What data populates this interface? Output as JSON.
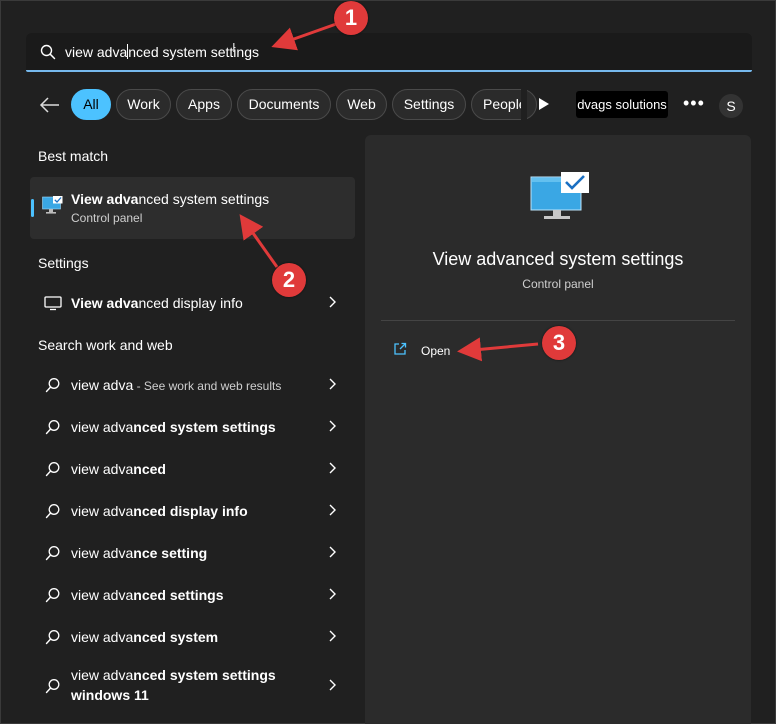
{
  "search": {
    "value_pre": "view adva",
    "value_post": "nced system settings",
    "ibeam": "I"
  },
  "filters": {
    "chips": [
      "All",
      "Work",
      "Apps",
      "Documents",
      "Web",
      "Settings",
      "People"
    ],
    "active": "All",
    "org_label": "dvags solutions",
    "more_label": "•••",
    "avatar_label": "S"
  },
  "sections": {
    "best_match": "Best match",
    "settings": "Settings",
    "search_web": "Search work and web"
  },
  "best_match": {
    "title_bold": "View adva",
    "title_rest": "nced system settings",
    "subtitle": "Control panel"
  },
  "settings_items": [
    {
      "bold": "View adva",
      "rest": "nced display info"
    }
  ],
  "web_items": [
    {
      "pre": "view adva",
      "post": "",
      "sub": " - See work and web results"
    },
    {
      "pre": "view adva",
      "post": "nced system settings",
      "sub": ""
    },
    {
      "pre": "view adva",
      "post": "nced",
      "sub": ""
    },
    {
      "pre": "view adva",
      "post": "nced display info",
      "sub": ""
    },
    {
      "pre": "view adva",
      "post": "nce setting",
      "sub": ""
    },
    {
      "pre": "view adva",
      "post": "nced settings",
      "sub": ""
    },
    {
      "pre": "view adva",
      "post": "nced system",
      "sub": ""
    },
    {
      "pre": "view adva",
      "post": "nced system settings windows 11",
      "sub": ""
    }
  ],
  "preview": {
    "title": "View advanced system settings",
    "subtitle": "Control panel",
    "open_label": "Open"
  },
  "annotations": [
    "1",
    "2",
    "3"
  ],
  "colors": {
    "accent": "#4cc2ff",
    "annotation": "#e03a3a",
    "background": "#202020"
  },
  "icons": {
    "search": "search-icon",
    "back": "back-arrow-icon",
    "play": "play-icon",
    "monitor": "monitor-icon",
    "chevron": "chevron-right-icon",
    "open": "open-external-icon"
  }
}
